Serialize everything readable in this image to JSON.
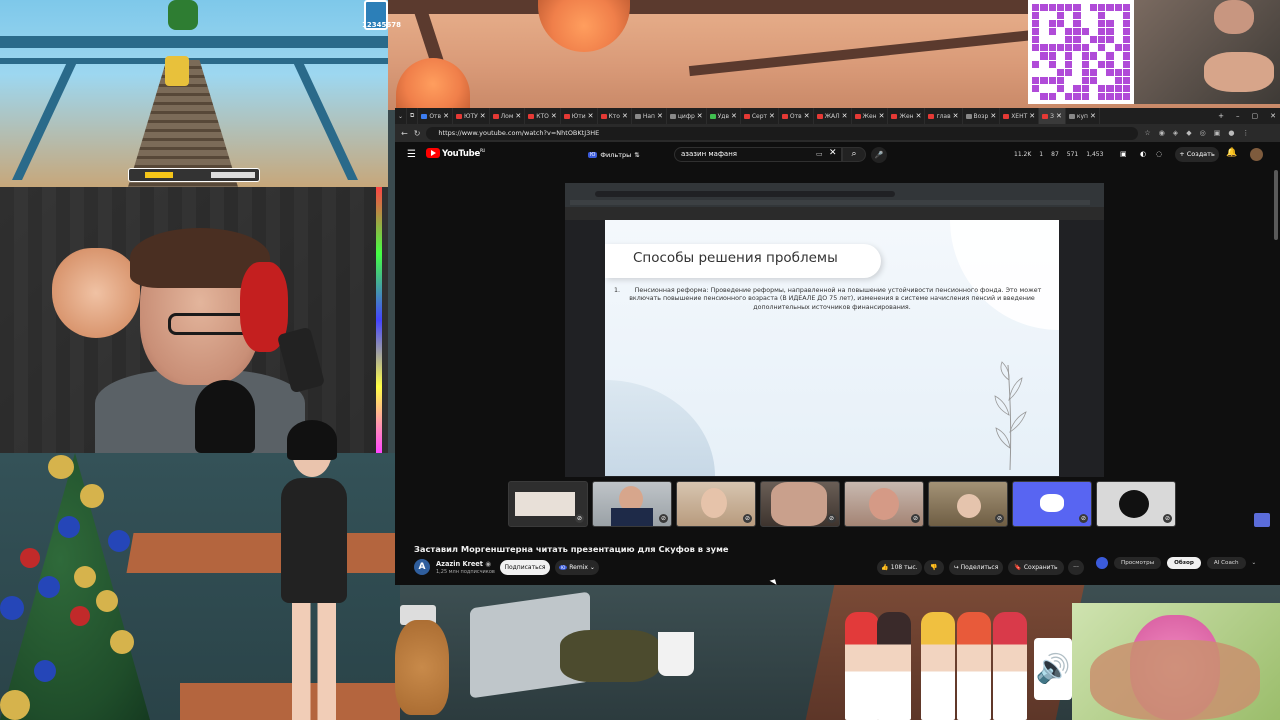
{
  "game": {
    "score": "12345678"
  },
  "browser": {
    "tabs": [
      {
        "label": "Отв",
        "color": "#3c7df0",
        "active": false
      },
      {
        "label": "ЮТУ",
        "color": "#e53935",
        "active": false
      },
      {
        "label": "Лом",
        "color": "#e53935",
        "active": false
      },
      {
        "label": "КТО",
        "color": "#e53935",
        "active": false
      },
      {
        "label": "Юти",
        "color": "#e53935",
        "active": false
      },
      {
        "label": "Кто",
        "color": "#e53935",
        "active": false
      },
      {
        "label": "Нап",
        "color": "#888888",
        "active": false
      },
      {
        "label": "цифр",
        "color": "#888888",
        "active": false
      },
      {
        "label": "Удв",
        "color": "#3fbf4f",
        "active": false
      },
      {
        "label": "Серт",
        "color": "#e53935",
        "active": false
      },
      {
        "label": "Отв",
        "color": "#e53935",
        "active": false
      },
      {
        "label": "ЖАЛ",
        "color": "#e53935",
        "active": false
      },
      {
        "label": "Жен",
        "color": "#e53935",
        "active": false
      },
      {
        "label": "Жен",
        "color": "#e53935",
        "active": false
      },
      {
        "label": "глав",
        "color": "#e53935",
        "active": false
      },
      {
        "label": "Возр",
        "color": "#888888",
        "active": false
      },
      {
        "label": "ХЕНТ",
        "color": "#e53935",
        "active": false
      },
      {
        "label": "З",
        "color": "#e53935",
        "active": true
      },
      {
        "label": "куп",
        "color": "#888888",
        "active": false
      }
    ],
    "url": "https://www.youtube.com/watch?v=NhtOBKtJ3HE"
  },
  "youtube": {
    "logo": "YouTube",
    "logo_sup": "RU",
    "filters_label": "Фильтры",
    "search_query": "азазин мафаня",
    "stats": [
      "11.2K",
      "1",
      "87",
      "571",
      "1,453"
    ],
    "create_label": "Создать",
    "video_title": "Заставил Моргенштерна читать презентацию для Скуфов в зуме",
    "channel_name": "Azazin Kreet",
    "channel_initial": "A",
    "subscribers": "1,25 млн подписчиков",
    "subscribe_label": "Подписаться",
    "remix_label": "Remix",
    "like_count": "108 тыс.",
    "share_label": "Поделиться",
    "save_label": "Сохранить",
    "more_label": "···",
    "side_tabs": [
      "Просмотры",
      "Обзор",
      "AI Coach"
    ]
  },
  "slide": {
    "title": "Способы решения проблемы",
    "item_number": "1.",
    "body": "Пенсионная реформа: Проведение реформы, направленной на повышение устойчивости пенсионного фонда. Это может включать повышение пенсионного возраста (В ИДЕАЛЕ ДО 75 лет), изменения в системе начисления пенсий и введение дополнительных источников финансирования."
  },
  "overlay": {
    "speaker_icon": "🔊"
  }
}
